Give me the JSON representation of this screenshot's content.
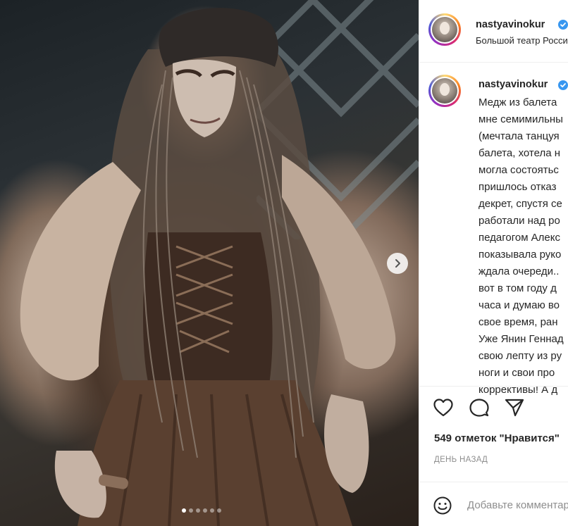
{
  "post": {
    "carousel": {
      "slide_count": 6,
      "active_index": 0
    }
  },
  "header": {
    "username": "nastyavinokur",
    "location": "Большой театр России"
  },
  "caption": {
    "username": "nastyavinokur",
    "lines": [
      "Медж из балета",
      "мне семимильны",
      "(мечтала танцуя",
      "балета, хотела н",
      "могла состоятьс",
      "пришлось отказ",
      "декрет, спустя се",
      "работали над ро",
      "педагогом Алекс",
      "показывала руко",
      "ждала очереди..",
      "вот в том году д",
      "часа и думаю во",
      "свое время, ран",
      "Уже Янин Геннад",
      "свою лепту из ру",
      "ноги и свои про",
      "коррективы! А д"
    ]
  },
  "likes_text": "549 отметок \"Нравится\"",
  "timestamp": "ДЕНЬ НАЗАД",
  "comment": {
    "placeholder": "Добавьте комментарий..."
  },
  "icons": {
    "like": "heart-icon",
    "comment": "comment-icon",
    "share": "paper-plane-icon",
    "emoji": "smiley-icon",
    "verified": "verified-badge-icon",
    "next": "chevron-right-icon"
  },
  "colors": {
    "verified": "#3897f0",
    "text": "#262626",
    "muted": "#8e8e8e",
    "divider": "#efefef"
  }
}
